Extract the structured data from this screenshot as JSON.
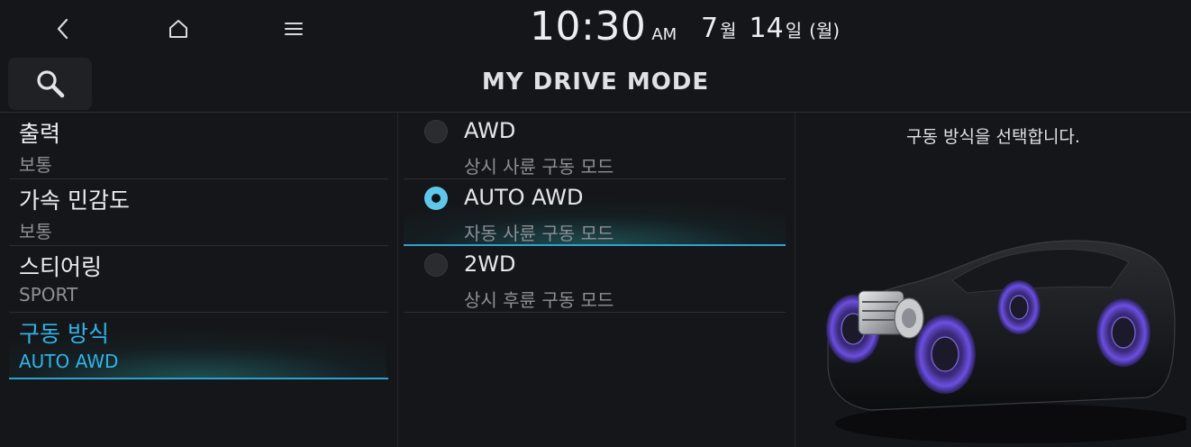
{
  "status_bar": {
    "time": "10:30",
    "ampm": "AM",
    "month": "7",
    "month_unit": "월",
    "day": "14",
    "day_unit": "일",
    "weekday": "(월)"
  },
  "header": {
    "title": "MY DRIVE MODE"
  },
  "sidebar": {
    "items": [
      {
        "label": "출력",
        "value": "보통"
      },
      {
        "label": "가속 민감도",
        "value": "보통"
      },
      {
        "label": "스티어링",
        "value": "SPORT"
      },
      {
        "label": "구동 방식",
        "value": "AUTO AWD"
      }
    ],
    "active_index": 3
  },
  "options": {
    "items": [
      {
        "label": "AWD",
        "sub": "상시 사륜 구동 모드"
      },
      {
        "label": "AUTO AWD",
        "sub": "자동 사륜 구동 모드"
      },
      {
        "label": "2WD",
        "sub": "상시 후륜 구동 모드"
      }
    ],
    "selected_index": 1
  },
  "detail": {
    "description": "구동 방식을 선택합니다."
  },
  "colors": {
    "accent": "#2fb4e8",
    "background": "#151619",
    "wheel_glow": "#6a3fd0"
  }
}
